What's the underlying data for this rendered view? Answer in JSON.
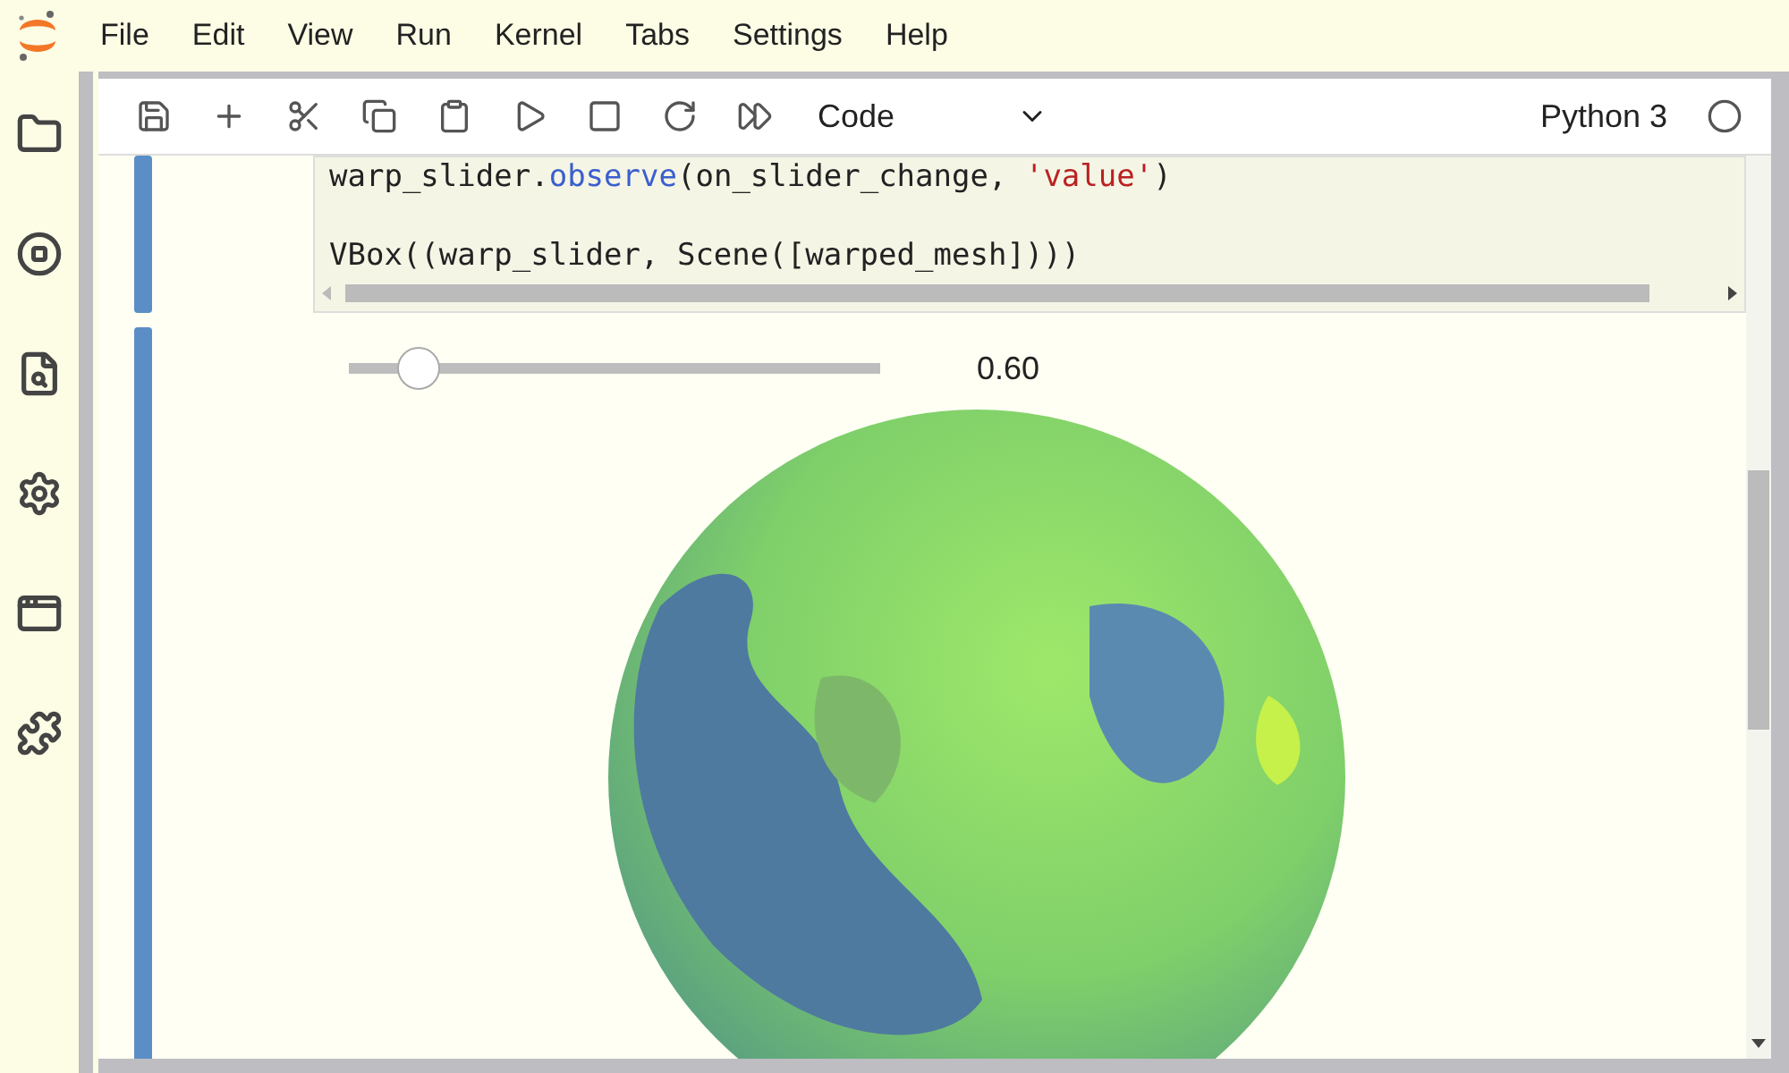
{
  "menu": [
    "File",
    "Edit",
    "View",
    "Run",
    "Kernel",
    "Tabs",
    "Settings",
    "Help"
  ],
  "sidebar": [
    {
      "kind": "folder"
    },
    {
      "kind": "running"
    },
    {
      "kind": "commands"
    },
    {
      "kind": "tools"
    },
    {
      "kind": "tabs"
    },
    {
      "kind": "extensions"
    }
  ],
  "toolbar": {
    "buttons": [
      {
        "kind": "save"
      },
      {
        "kind": "add"
      },
      {
        "kind": "cut"
      },
      {
        "kind": "copy"
      },
      {
        "kind": "paste"
      },
      {
        "kind": "run"
      },
      {
        "kind": "stop"
      },
      {
        "kind": "restart"
      },
      {
        "kind": "run-all"
      }
    ],
    "cell_type": "Code",
    "kernel": "Python 3",
    "kernel_busy": false
  },
  "cells": [
    {
      "kind": "code",
      "lines": [
        [
          {
            "kind": "plain",
            "text": "warp_slider."
          },
          {
            "kind": "attr",
            "text": "observe"
          },
          {
            "kind": "plain",
            "text": "(on_slider_change, "
          },
          {
            "kind": "string",
            "text": "'value'"
          },
          {
            "kind": "plain",
            "text": ")"
          }
        ],
        [
          {
            "kind": "plain",
            "text": "VBox((warp_slider, Scene([warped_mesh])))"
          }
        ]
      ]
    },
    {
      "kind": "output",
      "slider": {
        "level": 0.13,
        "reading": "0.60"
      }
    }
  ]
}
